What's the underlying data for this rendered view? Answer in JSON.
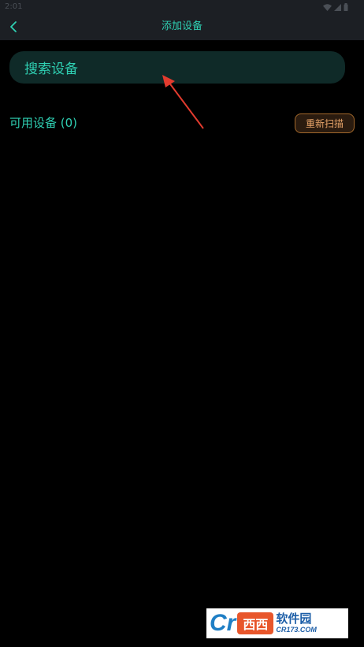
{
  "status_bar": {
    "time": "2:01",
    "icons": [
      "wifi-icon",
      "signal-icon",
      "battery-icon"
    ]
  },
  "app_bar": {
    "back_icon": "chevron-left-icon",
    "title": "添加设备"
  },
  "search": {
    "label": "搜索设备"
  },
  "devices": {
    "label": "可用设备 (0)",
    "rescan_label": "重新扫描"
  },
  "watermark": {
    "logo_text": "Cr",
    "box_text": "西西",
    "name": "软件园",
    "url": "CR173.COM"
  },
  "colors": {
    "background": "#000000",
    "bar": "#1c1f24",
    "accent": "#2fd0b3",
    "search_bg": "#0f2a28",
    "rescan_border": "#a3682b",
    "rescan_text": "#e9a56a",
    "arrow": "#e23b2e"
  }
}
